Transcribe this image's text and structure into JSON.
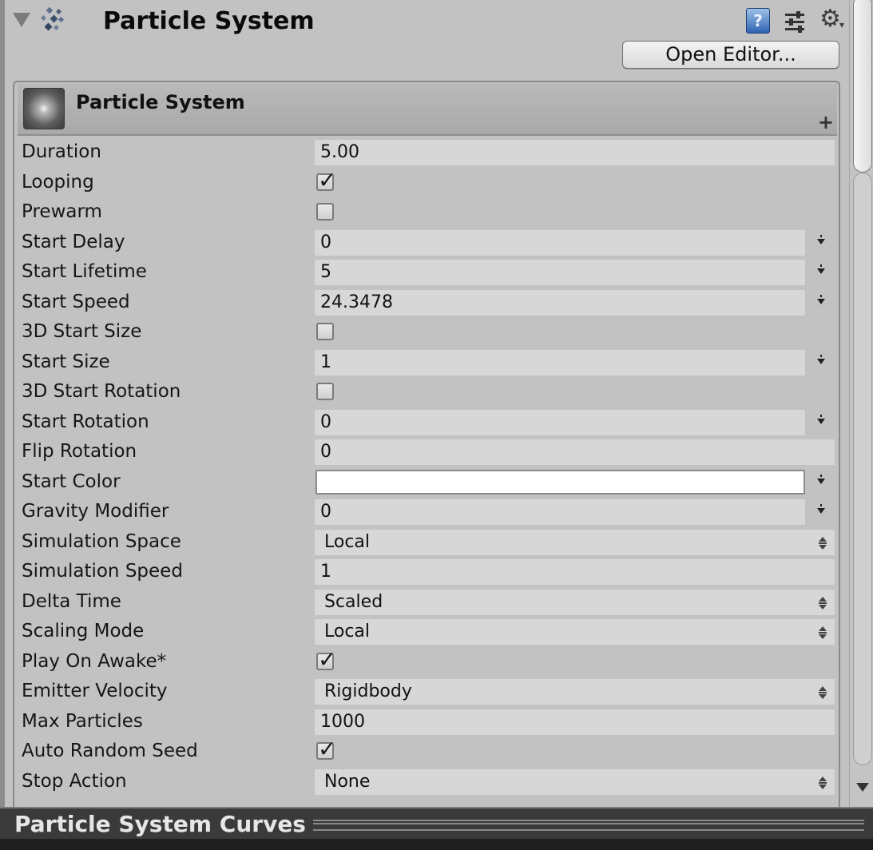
{
  "component": {
    "title": "Particle System",
    "open_editor_label": "Open Editor...",
    "help_icon_label": "?"
  },
  "module": {
    "title": "Particle System",
    "plus_label": "+"
  },
  "rows": [
    {
      "label": "Duration",
      "kind": "number",
      "value": "5.00"
    },
    {
      "label": "Looping",
      "kind": "checkbox",
      "checked": true
    },
    {
      "label": "Prewarm",
      "kind": "checkbox",
      "checked": false
    },
    {
      "label": "Start Delay",
      "kind": "curve",
      "value": "0"
    },
    {
      "label": "Start Lifetime",
      "kind": "curve",
      "value": "5"
    },
    {
      "label": "Start Speed",
      "kind": "curve",
      "value": "24.3478"
    },
    {
      "label": "3D Start Size",
      "kind": "checkbox",
      "checked": false
    },
    {
      "label": "Start Size",
      "kind": "curve",
      "value": "1"
    },
    {
      "label": "3D Start Rotation",
      "kind": "checkbox",
      "checked": false
    },
    {
      "label": "Start Rotation",
      "kind": "curve",
      "value": "0"
    },
    {
      "label": "Flip Rotation",
      "kind": "number",
      "value": "0"
    },
    {
      "label": "Start Color",
      "kind": "color",
      "value": "#ffffff"
    },
    {
      "label": "Gravity Modifier",
      "kind": "curve",
      "value": "0"
    },
    {
      "label": "Simulation Space",
      "kind": "popup",
      "value": "Local"
    },
    {
      "label": "Simulation Speed",
      "kind": "number",
      "value": "1"
    },
    {
      "label": "Delta Time",
      "kind": "popup",
      "value": "Scaled"
    },
    {
      "label": "Scaling Mode",
      "kind": "popup",
      "value": "Local"
    },
    {
      "label": "Play On Awake*",
      "kind": "checkbox",
      "checked": true
    },
    {
      "label": "Emitter Velocity",
      "kind": "popup",
      "value": "Rigidbody"
    },
    {
      "label": "Max Particles",
      "kind": "number",
      "value": "1000"
    },
    {
      "label": "Auto Random Seed",
      "kind": "checkbox",
      "checked": true
    },
    {
      "label": "Stop Action",
      "kind": "popup",
      "value": "None"
    }
  ],
  "curves_panel": {
    "title": "Particle System Curves"
  },
  "colors": {
    "background": "#c2c2c2",
    "field": "#d7d7d7",
    "curves_bar": "#3a3a3a",
    "help_icon": "#2f64b5"
  }
}
